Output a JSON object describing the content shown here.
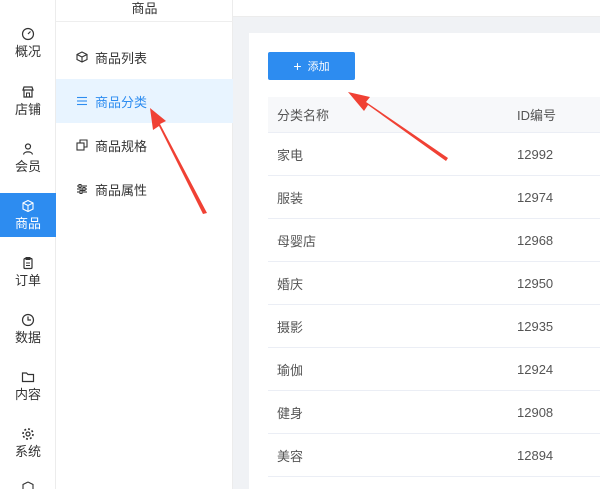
{
  "nav": {
    "items": [
      {
        "label": "概况",
        "icon": "dashboard-icon"
      },
      {
        "label": "店铺",
        "icon": "store-icon"
      },
      {
        "label": "会员",
        "icon": "user-icon"
      },
      {
        "label": "商品",
        "icon": "box-icon",
        "active": true
      },
      {
        "label": "订单",
        "icon": "clipboard-icon"
      },
      {
        "label": "数据",
        "icon": "clock-icon"
      },
      {
        "label": "内容",
        "icon": "folder-icon"
      },
      {
        "label": "系统",
        "icon": "gear-icon"
      }
    ]
  },
  "submenu": {
    "title": "商品",
    "items": [
      {
        "label": "商品列表",
        "icon": "box-icon"
      },
      {
        "label": "商品分类",
        "icon": "list-icon",
        "active": true
      },
      {
        "label": "商品规格",
        "icon": "copy-icon"
      },
      {
        "label": "商品属性",
        "icon": "sliders-icon"
      }
    ]
  },
  "toolbar": {
    "add_label": "添加"
  },
  "table": {
    "headers": [
      "分类名称",
      "ID编号"
    ],
    "rows": [
      {
        "name": "家电",
        "id": "12992"
      },
      {
        "name": "服装",
        "id": "12974"
      },
      {
        "name": "母婴店",
        "id": "12968"
      },
      {
        "name": "婚庆",
        "id": "12950"
      },
      {
        "name": "摄影",
        "id": "12935"
      },
      {
        "name": "瑜伽",
        "id": "12924"
      },
      {
        "name": "健身",
        "id": "12908"
      },
      {
        "name": "美容",
        "id": "12894"
      }
    ]
  },
  "colors": {
    "accent": "#2d8cf0",
    "annotation": "#f04134"
  }
}
